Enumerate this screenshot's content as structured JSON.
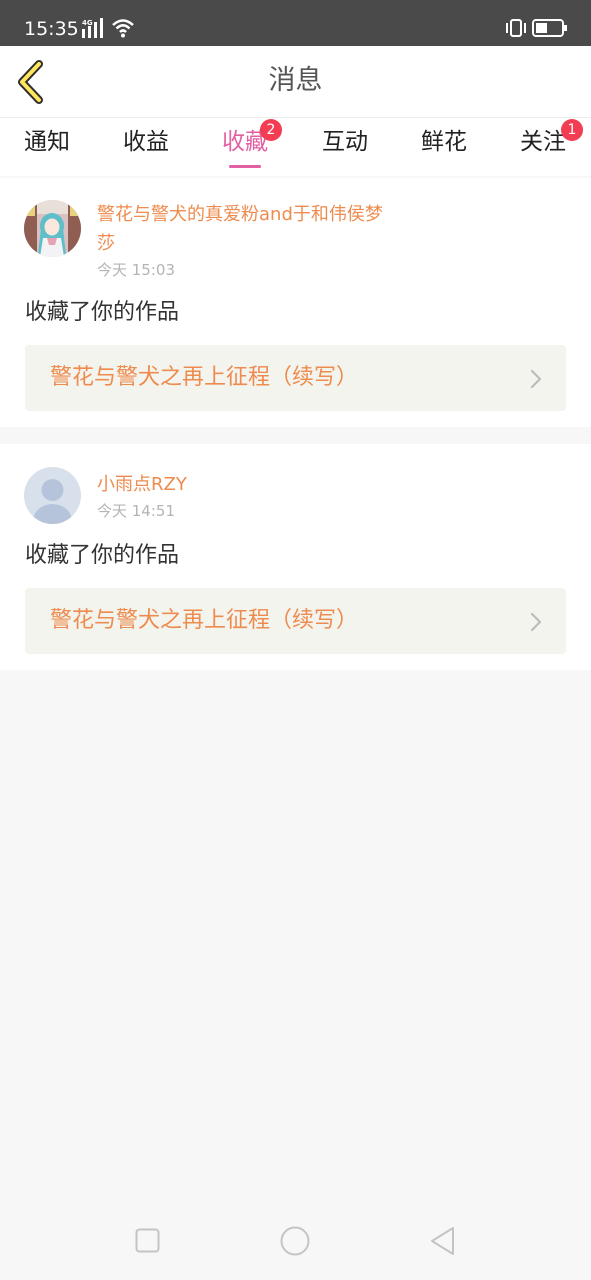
{
  "status_bar": {
    "time": "15:35",
    "network": "4G"
  },
  "header": {
    "title": "消息",
    "back_icon": "chevron-left-icon"
  },
  "tabs": [
    {
      "label": "通知",
      "badge": null,
      "active": false
    },
    {
      "label": "收益",
      "badge": null,
      "active": false
    },
    {
      "label": "收藏",
      "badge": "2",
      "active": true
    },
    {
      "label": "互动",
      "badge": null,
      "active": false
    },
    {
      "label": "鲜花",
      "badge": null,
      "active": false
    },
    {
      "label": "关注",
      "badge": "1",
      "active": false
    }
  ],
  "messages": [
    {
      "username": "警花与警犬的真爱粉and于和伟侯梦莎",
      "time": "今天 15:03",
      "action": "收藏了你的作品",
      "work_title": "警花与警犬之再上征程（续写）",
      "avatar": "anime-character-avatar"
    },
    {
      "username": "小雨点RZY",
      "time": "今天 14:51",
      "action": "收藏了你的作品",
      "work_title": "警花与警犬之再上征程（续写）",
      "avatar": "default-user-avatar"
    }
  ],
  "colors": {
    "accent": "#e25fa3",
    "badge": "#f23d53",
    "username": "#ee8b4e",
    "link_bg": "#f4f4ee",
    "status_bar": "#4a4a4a"
  }
}
